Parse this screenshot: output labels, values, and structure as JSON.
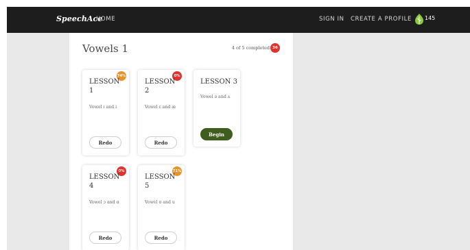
{
  "header": {
    "brand": "SpeechAce",
    "nav": {
      "home": "HOME",
      "sign_in": "SIGN IN",
      "create_profile": "CREATE A PROFILE"
    },
    "points": "145",
    "leaf_color": "#8dc63f"
  },
  "section": {
    "title": "Vowels 1",
    "progress_text": "4 of 5 completed",
    "progress_badge": "36"
  },
  "colors": {
    "badge_red": "#e0322e",
    "badge_orange": "#e8922a",
    "begin_green": "#3f5d1c"
  },
  "lessons": [
    {
      "title": "LESSON 1",
      "description": "Vowel ɪ and i",
      "badge": "74%",
      "badge_color": "orange",
      "button": "Redo"
    },
    {
      "title": "LESSON 2",
      "description": "Vowel ɛ and æ",
      "badge": "0%",
      "badge_color": "red",
      "button": "Redo"
    },
    {
      "title": "LESSON 3",
      "description": "Vowel ə and ʌ",
      "badge": "",
      "badge_color": "",
      "button": "Begin"
    },
    {
      "title": "LESSON 4",
      "description": "Vowel ɔ and ɑ",
      "badge": "0%",
      "badge_color": "red",
      "button": "Redo"
    },
    {
      "title": "LESSON 5",
      "description": "Vowel ʊ and u",
      "badge": "71%",
      "badge_color": "orange",
      "button": "Redo"
    }
  ]
}
